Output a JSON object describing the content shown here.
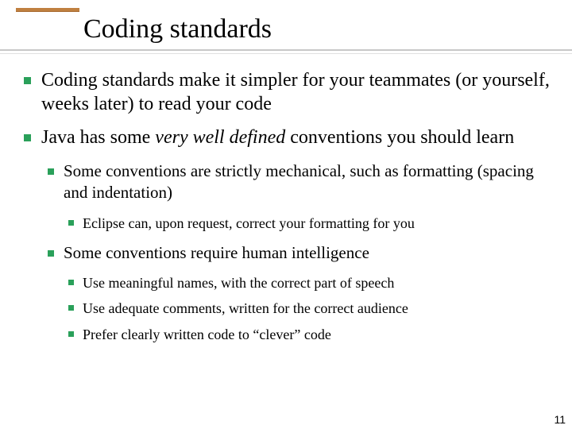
{
  "title": "Coding standards",
  "bullets": {
    "b1": "Coding standards make it simpler for your teammates (or yourself, weeks later) to read your code",
    "b2_pre": "Java has some ",
    "b2_em": "very well defined",
    "b2_post": " conventions you should learn",
    "b2_1": "Some conventions are strictly mechanical, such as formatting (spacing and indentation)",
    "b2_1_1": "Eclipse can, upon request, correct your formatting for you",
    "b2_2": "Some conventions require human intelligence",
    "b2_2_1": "Use meaningful names, with the correct part of speech",
    "b2_2_2": "Use adequate comments, written for the correct audience",
    "b2_2_3": "Prefer clearly written code to “clever” code"
  },
  "page_number": "11"
}
